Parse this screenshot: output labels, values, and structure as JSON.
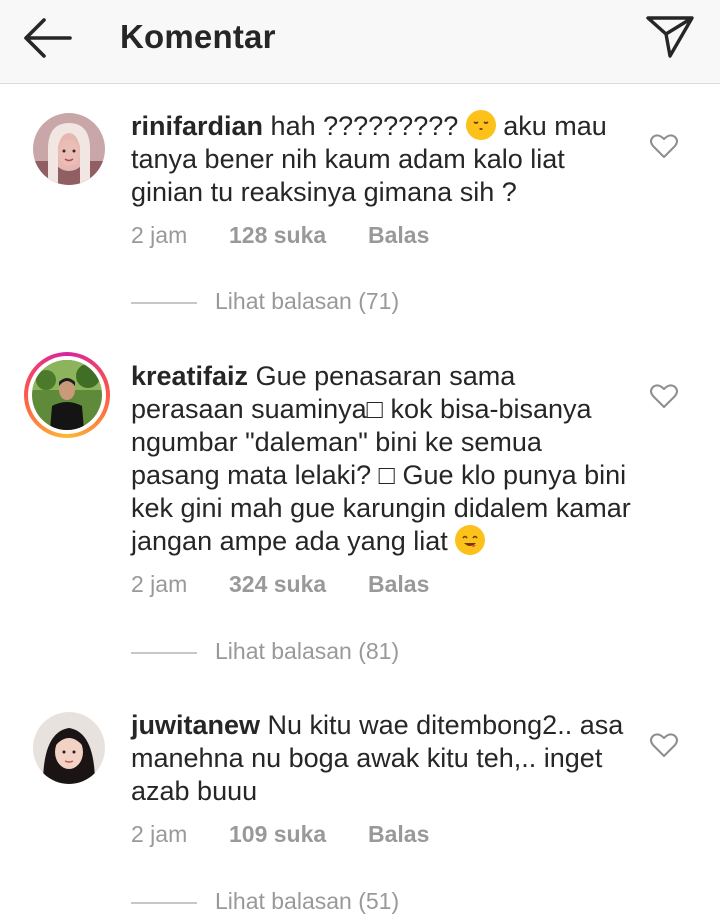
{
  "header": {
    "title": "Komentar",
    "back_icon": "arrow-left-icon",
    "send_icon": "paper-plane-icon"
  },
  "comments": [
    {
      "username": "rinifardian",
      "text_a": "hah ????????? ",
      "text_b": " aku mau tanya bener nih kaum adam kalo liat ginian tu reaksinya gimana sih ?",
      "time": "2 jam",
      "likes": "128 suka",
      "reply": "Balas",
      "view_replies": "Lihat balasan (71)"
    },
    {
      "username": "kreatifaiz",
      "text_a": "Gue penasaran sama perasaan suaminya□ kok bisa-bisanya ngumbar \"daleman\" bini ke semua pasang mata lelaki? □ Gue klo punya bini kek gini mah gue karungin didalem kamar jangan ampe ada yang liat ",
      "time": "2 jam",
      "likes": "324 suka",
      "reply": "Balas",
      "view_replies": "Lihat balasan (81)"
    },
    {
      "username": "juwitanew",
      "text_a": "Nu kitu wae ditembong2.. asa manehna nu boga awak kitu teh,.. inget azab buuu",
      "time": "2 jam",
      "likes": "109 suka",
      "reply": "Balas",
      "view_replies": "Lihat balasan (51)"
    }
  ],
  "colors": {
    "header_bg": "#f8f8f8",
    "text": "#262626",
    "muted": "#999999",
    "emoji": "#fcc21b"
  }
}
